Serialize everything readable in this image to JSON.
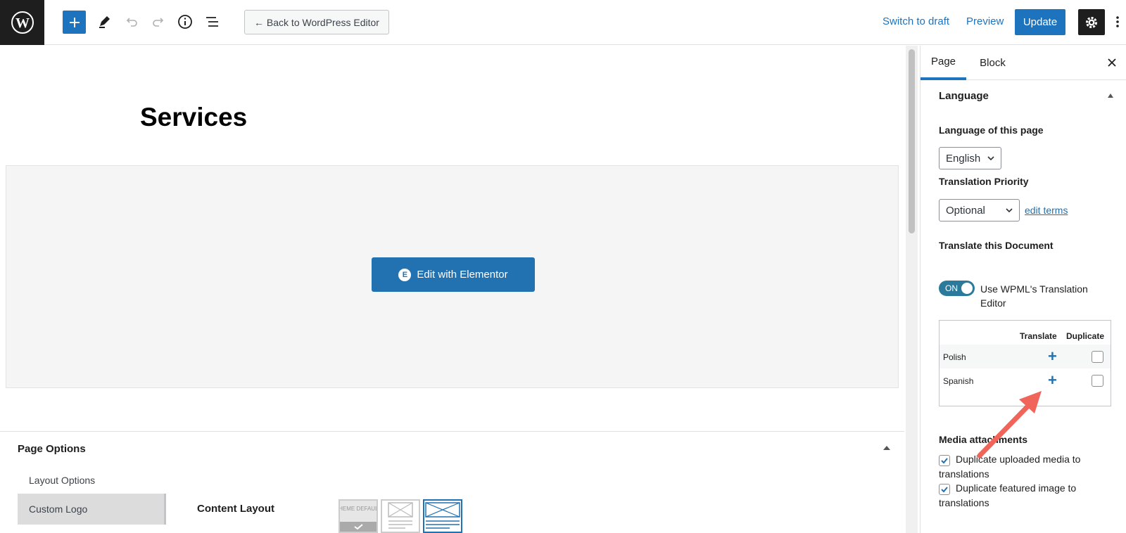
{
  "topbar": {
    "back_label": "← Back to WordPress Editor",
    "switch_draft": "Switch to draft",
    "preview": "Preview",
    "update": "Update"
  },
  "editor": {
    "page_title": "Services",
    "elementor_button": "Edit with Elementor",
    "elementor_icon": "E"
  },
  "page_options": {
    "title": "Page Options",
    "layout_options": "Layout Options",
    "custom_logo": "Custom Logo",
    "content_layout": "Content Layout",
    "thumb_theme_default": "THEME DEFAULT"
  },
  "sidebar": {
    "tabs": [
      {
        "label": "Page"
      },
      {
        "label": "Block"
      }
    ],
    "language_section": "Language",
    "language_of_page_label": "Language of this page",
    "language_value": "English",
    "translation_priority_label": "Translation Priority",
    "priority_value": "Optional",
    "edit_terms": "edit terms",
    "translate_doc_label": "Translate this Document",
    "toggle_state": "ON",
    "toggle_label": "Use WPML's Translation Editor",
    "table": {
      "headers": {
        "translate": "Translate",
        "duplicate": "Duplicate"
      },
      "rows": [
        {
          "language": "Polish",
          "action": "+"
        },
        {
          "language": "Spanish",
          "action": "+"
        }
      ]
    },
    "media_label": "Media attachments",
    "checkboxes": [
      {
        "label": "Duplicate uploaded media to translations",
        "checked": true
      },
      {
        "label": "Duplicate featured image to translations",
        "checked": true
      }
    ]
  },
  "colors": {
    "accent": "#1e73be",
    "annotation_arrow": "#f0645a"
  }
}
